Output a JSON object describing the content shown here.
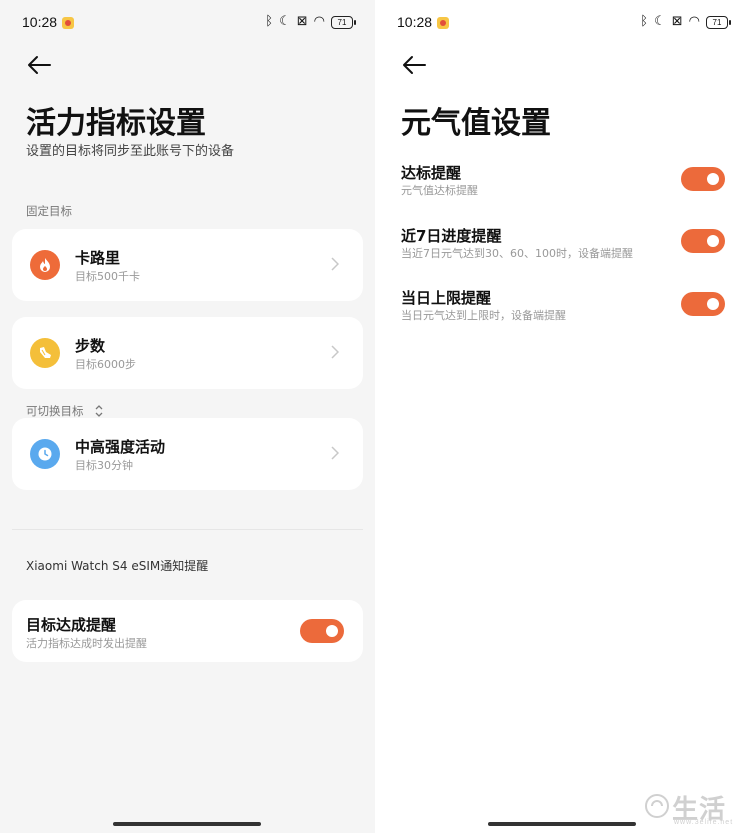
{
  "status_bar": {
    "time": "10:28",
    "battery": "71",
    "icons": [
      "bluetooth-icon",
      "moon-icon",
      "sim-off-icon",
      "wifi-icon",
      "battery-icon"
    ]
  },
  "left_screen": {
    "title": "活力指标设置",
    "subtitle": "设置的目标将同步至此账号下的设备",
    "fixed_section_label": "固定目标",
    "switchable_section_label": "可切换目标",
    "goals": [
      {
        "title": "卡路里",
        "subtitle": "目标500千卡",
        "icon": "flame-icon",
        "color": "#ee6b39"
      },
      {
        "title": "步数",
        "subtitle": "目标6000步",
        "icon": "shoe-icon",
        "color": "#f4bf3a"
      },
      {
        "title": "中高强度活动",
        "subtitle": "目标30分钟",
        "icon": "clock-icon",
        "color": "#5aa9ee"
      }
    ],
    "device_label": "Xiaomi Watch S4 eSIM通知提醒",
    "goal_reminder": {
      "title": "目标达成提醒",
      "subtitle": "活力指标达成时发出提醒",
      "enabled": true
    }
  },
  "right_screen": {
    "title": "元气值设置",
    "settings": [
      {
        "title": "达标提醒",
        "subtitle": "元气值达标提醒",
        "enabled": true
      },
      {
        "title": "近7日进度提醒",
        "subtitle": "当近7日元气达到30、60、100时，设备端提醒",
        "enabled": true
      },
      {
        "title": "当日上限提醒",
        "subtitle": "当日元气达到上限时，设备端提醒",
        "enabled": true
      }
    ]
  },
  "watermark": {
    "text": "生活",
    "url": "www.3elife.net"
  },
  "colors": {
    "accent": "#ec6a3b",
    "left_bg": "#f5f5f5",
    "card_bg": "#ffffff"
  }
}
